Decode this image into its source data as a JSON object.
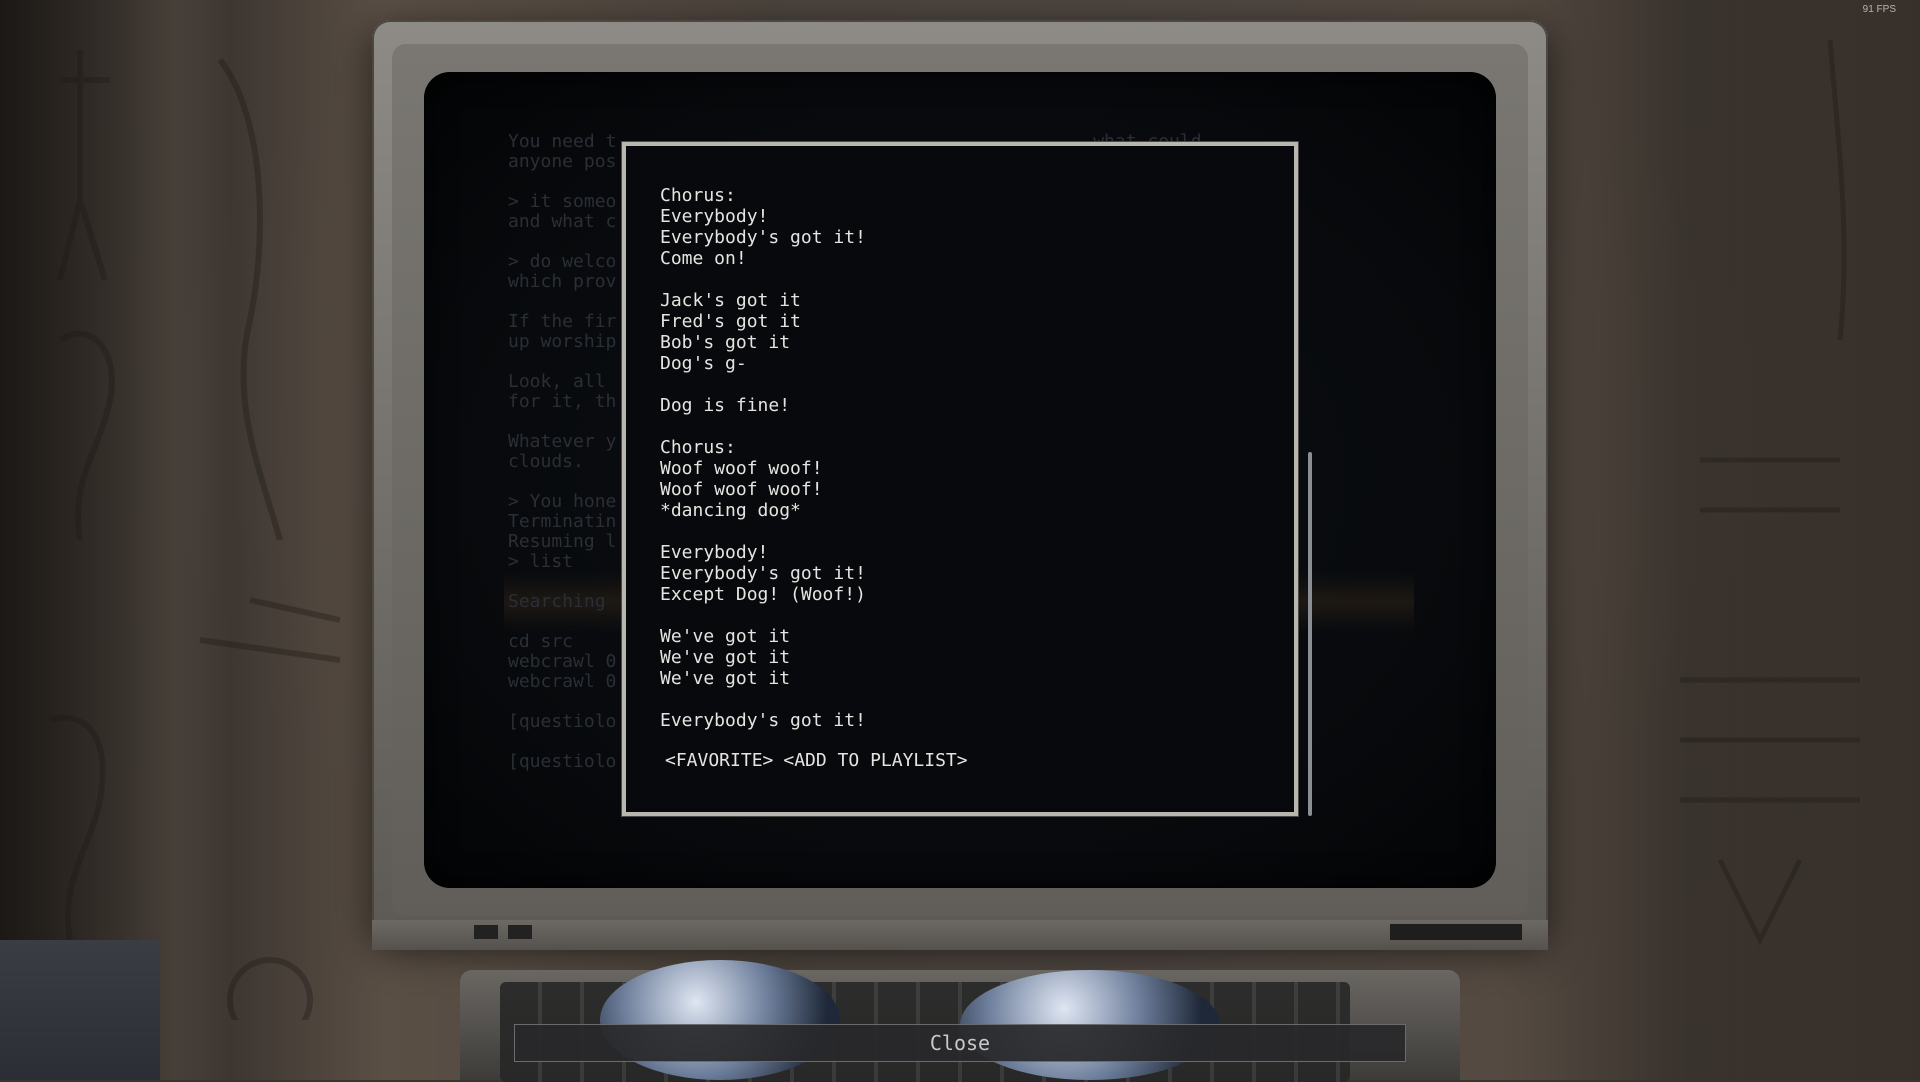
{
  "hud": {
    "fps": "91 FPS"
  },
  "background_text": {
    "lines": [
      "You need t                                            what could",
      "anyone pos",
      "",
      "> it someo",
      "and what c",
      "",
      "> do welco",
      "which prov",
      "",
      "If the fir                                            ave ended",
      "up worship",
      "",
      "Look, all                                             se's waiting",
      "for it, th",
      "",
      "Whatever y                                            in the",
      "clouds.",
      "",
      "> You hone",
      "Terminatin",
      "Resuming l",
      "> list",
      "",
      "Searching",
      "",
      "cd src",
      "webcrawl 0",
      "webcrawl 0",
      "",
      "[questiolo",
      "",
      "[questiolo"
    ]
  },
  "dialog": {
    "lines": [
      "Chorus:",
      "Everybody!",
      "Everybody's got it!",
      "Come on!",
      "",
      "Jack's got it",
      "Fred's got it",
      "Bob's got it",
      "Dog's g-",
      "",
      "Dog is fine!",
      "",
      "Chorus:",
      "Woof woof woof!",
      "Woof woof woof!",
      "*dancing dog*",
      "",
      "Everybody!",
      "Everybody's got it!",
      "Except Dog! (Woof!)",
      "",
      "We've got it",
      "We've got it",
      "We've got it",
      "",
      "Everybody's got it!"
    ],
    "favorite_label": "<FAVORITE>",
    "playlist_label": "<ADD TO PLAYLIST>"
  },
  "close_label": "Close",
  "colors": {
    "screen_text": "#e6e4e0",
    "dialog_border": "#b9b6b0",
    "screen_bg": "#07090c"
  }
}
